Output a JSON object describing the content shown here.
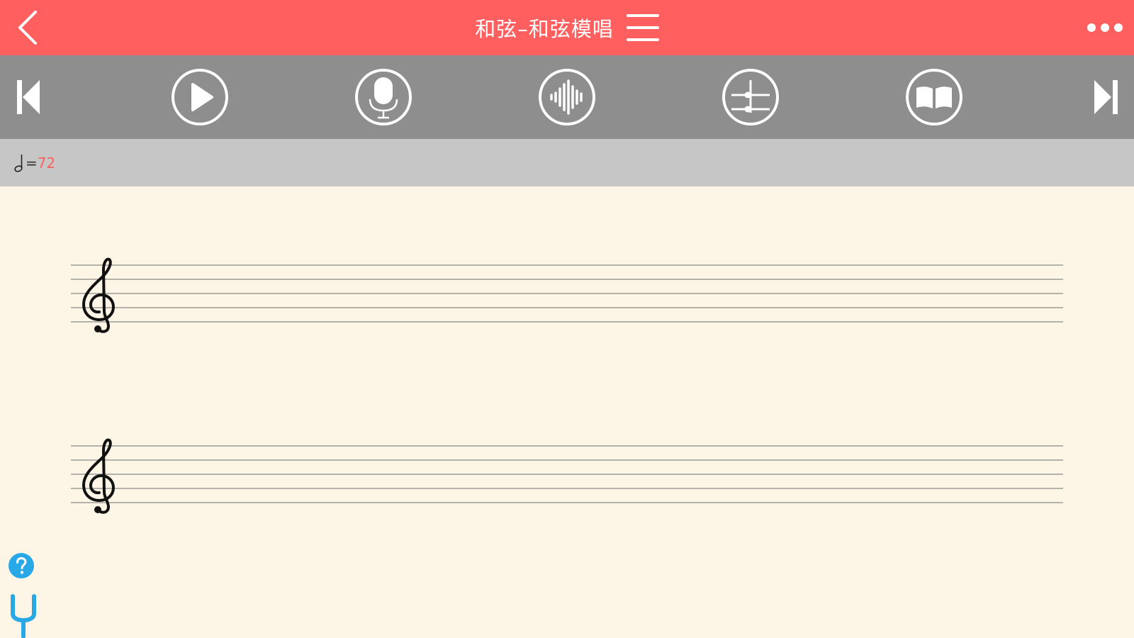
{
  "header": {
    "title": "和弦–和弦模唱",
    "bg_color": "#ff5f5f"
  },
  "icons": {
    "back": "chevron-left-icon",
    "menu": "hamburger-menu-icon",
    "more": "more-dots-icon",
    "previous": "skip-previous-icon",
    "play": "play-icon",
    "record": "microphone-icon",
    "waveform": "waveform-icon",
    "mixer": "mixer-slider-icon",
    "book": "open-book-icon",
    "next": "skip-next-icon",
    "help": "help-question-icon",
    "tuning_fork": "tuning-fork-icon",
    "tempo_note": "half-note-icon",
    "clef": "treble-clef-icon"
  },
  "tempo": {
    "equals": "=",
    "value": "72"
  },
  "score": {
    "staves": 2
  },
  "colors": {
    "accent": "#ff5f5f",
    "toolbar": "#8e8e8e",
    "tempo_bar": "#c6c6c6",
    "paper": "#fdf5e6",
    "help_blue": "#29a8e8"
  }
}
